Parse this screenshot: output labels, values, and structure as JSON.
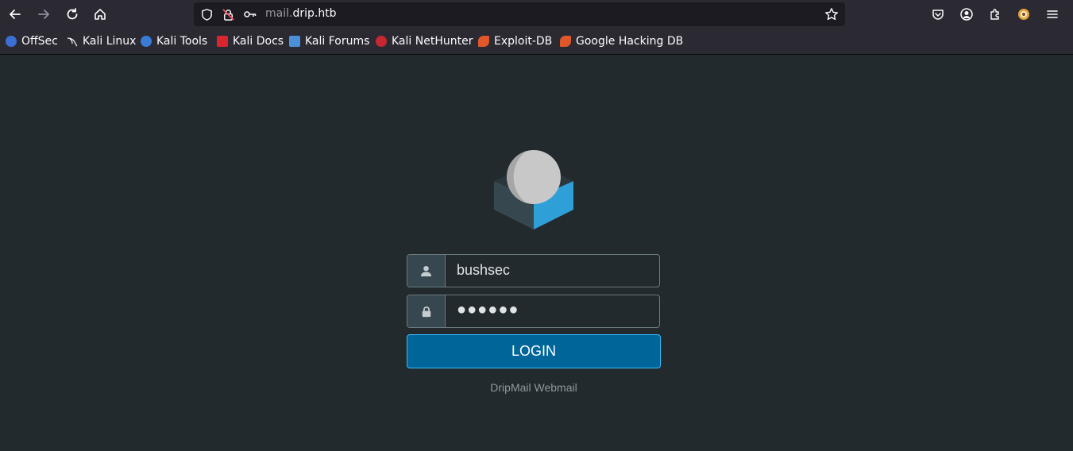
{
  "browser": {
    "url_subdomain": "mail.",
    "url_domain": "drip.htb",
    "bookmarks": [
      {
        "label": "OffSec",
        "color": "#3b6fd4"
      },
      {
        "label": "Kali Linux",
        "color": "#2b2a33"
      },
      {
        "label": "Kali Tools",
        "color": "#3a7bd5"
      },
      {
        "label": "Kali Docs",
        "color": "#d9262e"
      },
      {
        "label": "Kali Forums",
        "color": "#4a90d9"
      },
      {
        "label": "Kali NetHunter",
        "color": "#c82630"
      },
      {
        "label": "Exploit-DB",
        "color": "#e0582a"
      },
      {
        "label": "Google Hacking DB",
        "color": "#e0582a"
      }
    ]
  },
  "login": {
    "username": "bushsec",
    "password_mask": "●●●●●●",
    "button_label": "LOGIN",
    "product_name": "DripMail Webmail"
  },
  "colors": {
    "page_bg": "#222a2d",
    "accent": "#00669a",
    "logo_blue": "#2f9fd8",
    "logo_dark": "#37474f"
  }
}
